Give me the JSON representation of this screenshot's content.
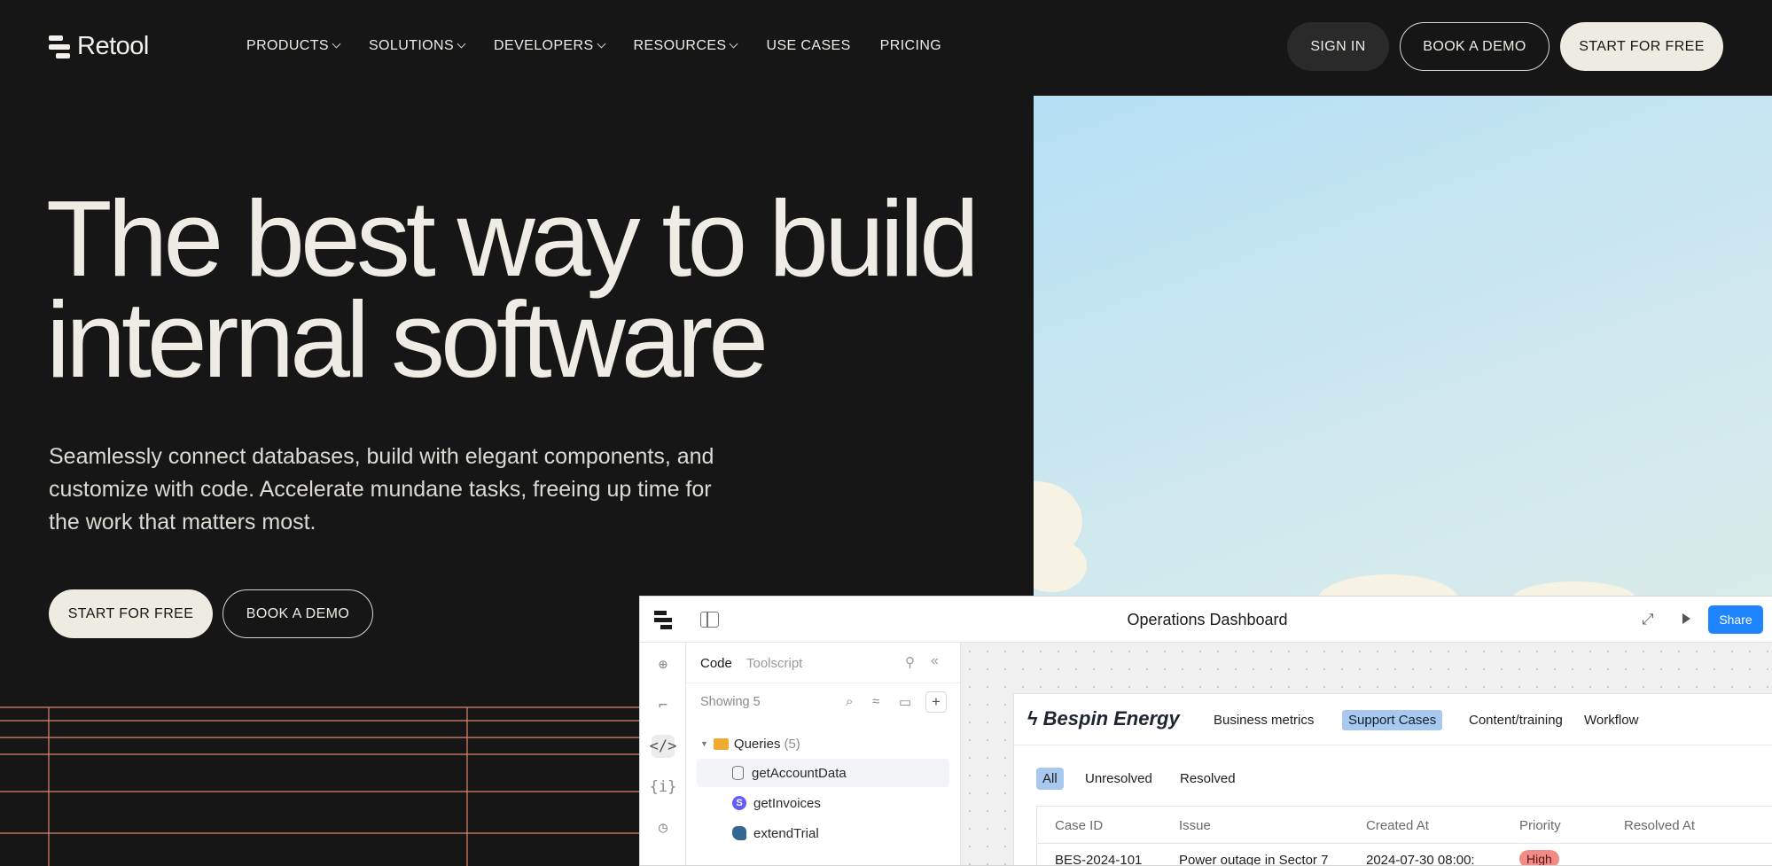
{
  "nav": {
    "brand": "Retool",
    "links": [
      {
        "label": "PRODUCTS",
        "dropdown": true
      },
      {
        "label": "SOLUTIONS",
        "dropdown": true
      },
      {
        "label": "DEVELOPERS",
        "dropdown": true
      },
      {
        "label": "RESOURCES",
        "dropdown": true
      },
      {
        "label": "USE CASES",
        "dropdown": false
      },
      {
        "label": "PRICING",
        "dropdown": false
      }
    ],
    "sign_in": "SIGN IN",
    "book_demo": "BOOK A DEMO",
    "start_free": "START FOR FREE"
  },
  "hero": {
    "title_line1": "The best way to build",
    "title_line2": "internal software",
    "subtitle": "Seamlessly connect databases, build with elegant components, and customize with code. Accelerate mundane tasks, freeing up time for the work that matters most.",
    "cta_primary": "START FOR FREE",
    "cta_secondary": "BOOK A DEMO"
  },
  "dashboard": {
    "title": "Operations Dashboard",
    "share": "Share",
    "code_panel": {
      "tab_code": "Code",
      "tab_toolscript": "Toolscript",
      "showing": "Showing 5",
      "folder_label": "Queries",
      "folder_count": "(5)",
      "queries": [
        "getAccountData",
        "getInvoices",
        "extendTrial"
      ]
    },
    "app": {
      "brand": "Bespin Energy",
      "tabs": [
        "Business metrics",
        "Support Cases",
        "Content/training",
        "Workflow"
      ],
      "active_tab": "Support Cases",
      "filters": [
        "All",
        "Unresolved",
        "Resolved"
      ],
      "active_filter": "All",
      "columns": [
        "Case ID",
        "Issue",
        "Created At",
        "Priority",
        "Resolved At"
      ],
      "rows": [
        {
          "case_id": "BES-2024-101",
          "issue": "Power outage in Sector 7",
          "created_at": "2024-07-30 08:00:",
          "priority": "High",
          "resolved_at": ""
        }
      ]
    }
  },
  "colors": {
    "background": "#161616",
    "text": "#eeece4",
    "cream_button": "#eeece0",
    "grid_line": "#e0866a",
    "share_blue": "#1f85ff",
    "tab_highlight": "#a9c8ee",
    "priority_high": "#f28b86"
  }
}
